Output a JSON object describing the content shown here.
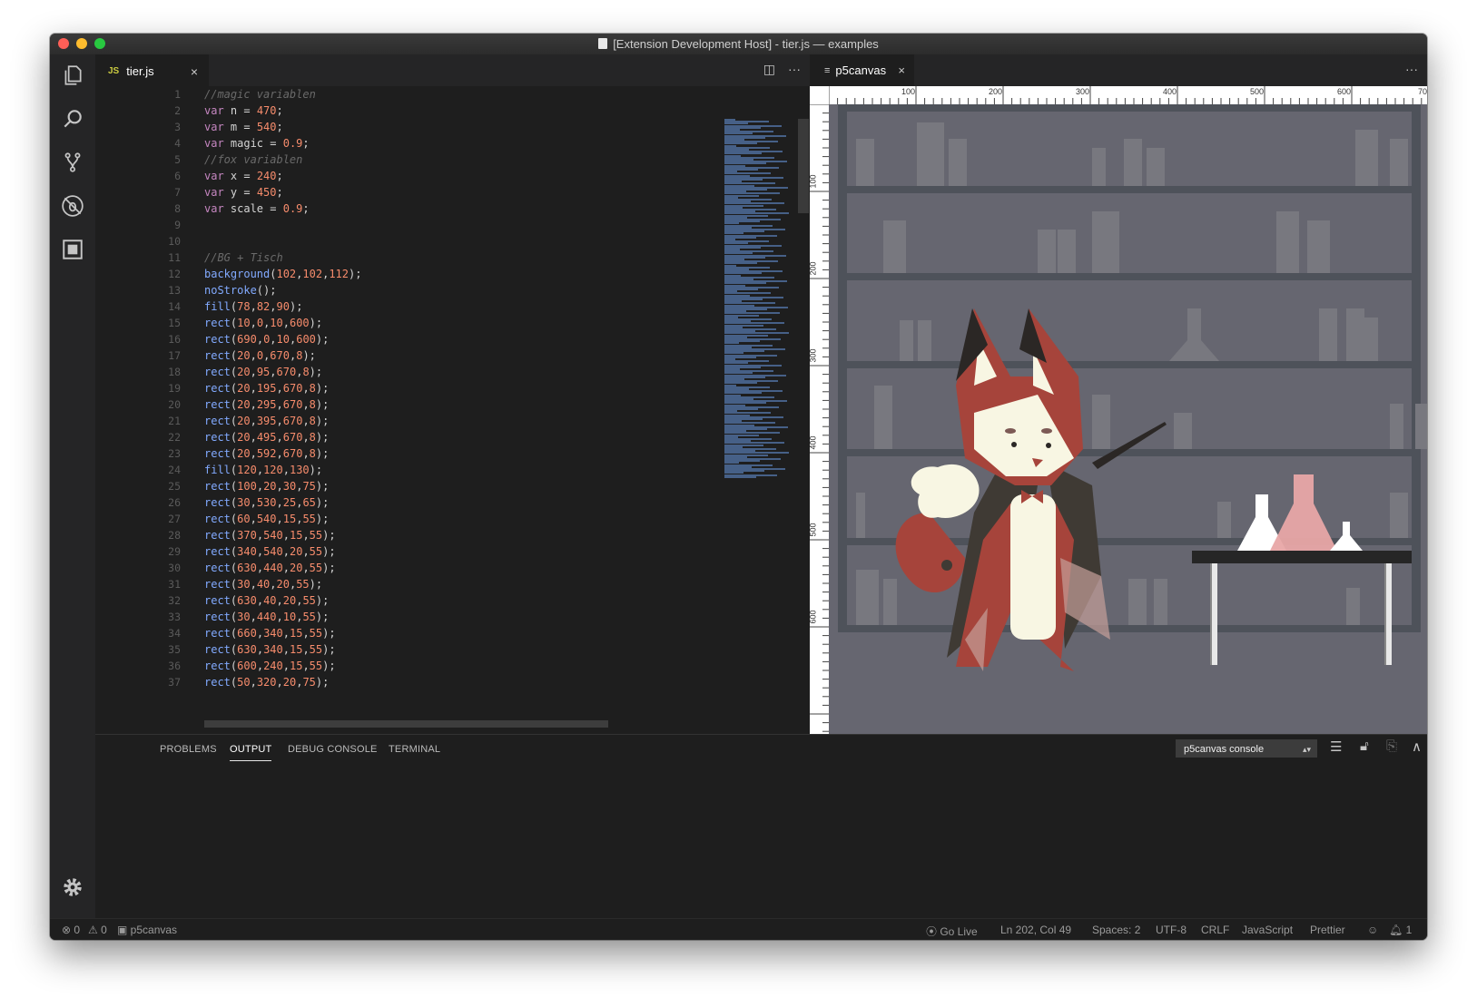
{
  "window": {
    "title": "[Extension Development Host] - tier.js — examples"
  },
  "activity_bar": {
    "icons": [
      "files-icon",
      "search-icon",
      "source-control-icon",
      "debug-icon",
      "extensions-icon",
      "gear-icon"
    ]
  },
  "editor": {
    "tab": {
      "lang_badge": "JS",
      "label": "tier.js",
      "close": "×"
    },
    "actions": {
      "split": "◫",
      "more": "···"
    },
    "line_numbers": [
      "1",
      "2",
      "3",
      "4",
      "5",
      "6",
      "7",
      "8",
      "9",
      "10",
      "11",
      "12",
      "13",
      "14",
      "15",
      "16",
      "17",
      "18",
      "19",
      "20",
      "21",
      "22",
      "23",
      "24",
      "25",
      "26",
      "27",
      "28",
      "29",
      "30",
      "31",
      "32",
      "33",
      "34",
      "35",
      "36",
      "37"
    ],
    "lines": [
      "//magic variablen",
      "var n = 470;",
      "var m = 540;",
      "var magic = 0.9;",
      "//fox variablen",
      "var x = 240;",
      "var y = 450;",
      "var scale = 0.9;",
      "",
      "",
      "//BG + Tisch",
      "background(102,102,112);",
      "noStroke();",
      "fill(78,82,90);",
      "rect(10,0,10,600);",
      "rect(690,0,10,600);",
      "rect(20,0,670,8);",
      "rect(20,95,670,8);",
      "rect(20,195,670,8);",
      "rect(20,295,670,8);",
      "rect(20,395,670,8);",
      "rect(20,495,670,8);",
      "rect(20,592,670,8);",
      "fill(120,120,130);",
      "rect(100,20,30,75);",
      "rect(30,530,25,65);",
      "rect(60,540,15,55);",
      "rect(370,540,15,55);",
      "rect(340,540,20,55);",
      "rect(630,440,20,55);",
      "rect(30,40,20,55);",
      "rect(630,40,20,55);",
      "rect(30,440,10,55);",
      "rect(660,340,15,55);",
      "rect(630,340,15,55);",
      "rect(600,240,15,55);",
      "rect(50,320,20,75);"
    ]
  },
  "preview": {
    "tab": {
      "icon": "≡",
      "label": "p5canvas",
      "close": "×"
    },
    "more": "···",
    "ruler_top": [
      "100",
      "200",
      "300",
      "400",
      "500",
      "600",
      "70"
    ],
    "ruler_left": [
      "100",
      "200",
      "300",
      "400",
      "500",
      "600"
    ]
  },
  "panel": {
    "tabs": [
      "PROBLEMS",
      "OUTPUT",
      "DEBUG CONSOLE",
      "TERMINAL"
    ],
    "active_tab": "OUTPUT",
    "output_channel": "p5canvas console",
    "icons": [
      "clear-output-icon",
      "lock-icon",
      "copy-icon",
      "maximize-panel-icon",
      "close-panel-icon"
    ]
  },
  "status_bar": {
    "errors": "0",
    "warnings": "0",
    "p5canvas": "p5canvas",
    "go_live": "Go Live",
    "position": "Ln 202, Col 49",
    "spaces": "Spaces: 2",
    "encoding": "UTF-8",
    "eol": "CRLF",
    "language": "JavaScript",
    "formatter": "Prettier",
    "notifications": "1"
  },
  "colors": {
    "background": "#1e1e1e",
    "canvas_bg": "#666670",
    "shelf": "#4e525a",
    "books": "#78787f",
    "fox_red": "#a6443b",
    "fox_cream": "#f8f6e3"
  }
}
